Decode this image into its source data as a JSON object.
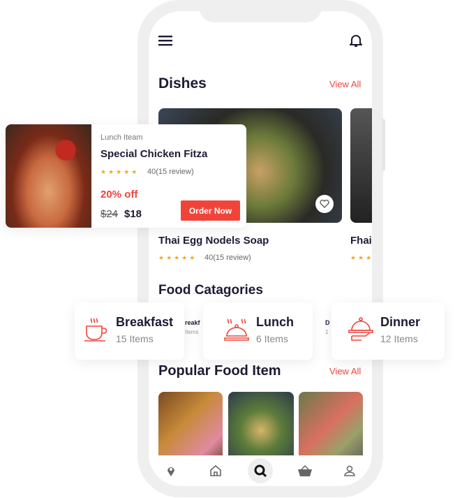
{
  "header": {
    "menu_icon": "hamburger-icon",
    "notification_icon": "bell-icon"
  },
  "dishes": {
    "title": "Dishes",
    "view_all": "View All",
    "items": [
      {
        "name": "Thai Egg Nodels Soap",
        "stars": "★★★★★",
        "reviews": "40(15 review)"
      },
      {
        "name": "Fhai",
        "stars": "★★★"
      }
    ]
  },
  "promo": {
    "category": "Lunch Iteam",
    "name": "Special Chicken Fitza",
    "stars": "★★★★★",
    "reviews": "40(15 review)",
    "discount": "20% off",
    "old_price": "$24",
    "price": "$18",
    "order_label": "Order Now"
  },
  "categories": {
    "title": "Food Catagories",
    "items": [
      {
        "name": "Breakfast",
        "count": "15 Items",
        "icon": "coffee-cup-icon"
      },
      {
        "name": "Lunch",
        "count": "6 Items",
        "icon": "cloche-icon"
      },
      {
        "name": "Dinner",
        "count": "12 Items",
        "icon": "serving-tray-icon"
      }
    ],
    "behind": {
      "name": "reakf",
      "count": "Items",
      "name2": "D",
      "count2": "1"
    }
  },
  "popular": {
    "title": "Popular Food Item",
    "view_all": "View All"
  },
  "nav": [
    "location-icon",
    "home-icon",
    "search-icon",
    "basket-icon",
    "user-icon"
  ],
  "colors": {
    "accent": "#f0443a",
    "star": "#f5a623",
    "text": "#1d1b33"
  }
}
